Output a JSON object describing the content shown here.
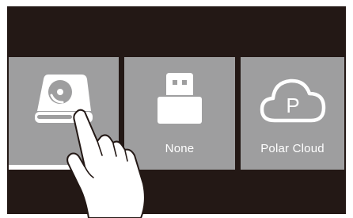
{
  "tiles": [
    {
      "id": "local-storage",
      "icon": "hard-drive-icon",
      "label": ""
    },
    {
      "id": "usb",
      "icon": "usb-drive-icon",
      "label": "None"
    },
    {
      "id": "polar-cloud",
      "icon": "cloud-p-icon",
      "label": "Polar Cloud",
      "icon_text": "P"
    }
  ],
  "colors": {
    "screen": "#231815",
    "tile": "#9e9e9f",
    "highlight": "#ffffff"
  },
  "pointer": "hand-pointer-icon"
}
